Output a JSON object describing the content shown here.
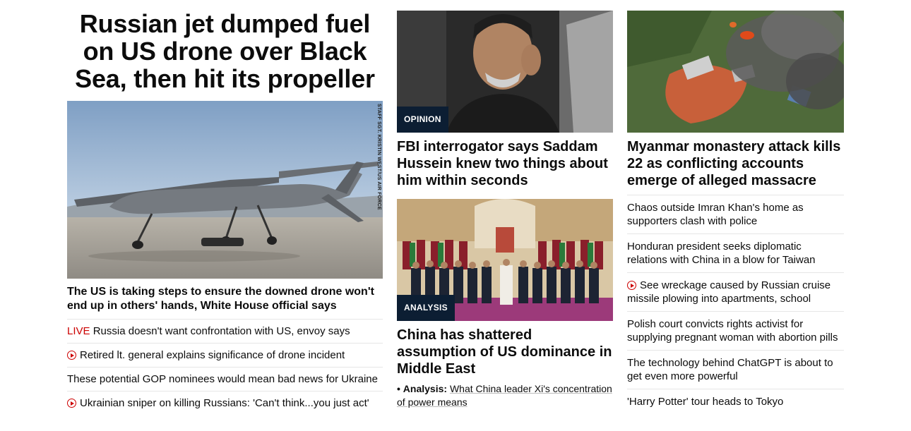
{
  "lead": {
    "title": "Russian jet dumped fuel on US drone over Black Sea, then hit its propeller",
    "image_credit": "STAFF SGT. KRISTIN WEST/US AIR FORCE",
    "subhead": "The US is taking steps to ensure the downed drone won't end up in others' hands, White House official says",
    "items": [
      {
        "prefix": "LIVE",
        "text": "Russia doesn't want confrontation with US, envoy says"
      },
      {
        "icon": "play",
        "text": "Retired lt. general explains significance of drone incident"
      },
      {
        "text": "These potential GOP nominees would mean bad news for Ukraine"
      },
      {
        "icon": "play",
        "text": "Ukrainian sniper on killing Russians: 'Can't think...you just act'"
      }
    ]
  },
  "middle": {
    "story1": {
      "badge": "OPINION",
      "headline": "FBI interrogator says Saddam Hussein knew two things about him within seconds"
    },
    "story2": {
      "badge": "ANALYSIS",
      "headline": "China has shattered assumption of US dominance in Middle East",
      "analysis_bullet": "•",
      "analysis_label": "Analysis:",
      "analysis_link": "What China leader Xi's concentration of power means"
    }
  },
  "right": {
    "headline": "Myanmar monastery attack kills 22 as conflicting accounts emerge of alleged massacre",
    "items": [
      {
        "text": "Chaos outside Imran Khan's home as supporters clash with police"
      },
      {
        "text": "Honduran president seeks diplomatic relations with China in a blow for Taiwan"
      },
      {
        "icon": "play",
        "text": "See wreckage caused by Russian cruise missile plowing into apartments, school"
      },
      {
        "text": "Polish court convicts rights activist for supplying pregnant woman with abortion pills"
      },
      {
        "text": "The technology behind ChatGPT is about to get even more powerful"
      },
      {
        "text": "'Harry Potter' tour heads to Tokyo"
      }
    ]
  },
  "colors": {
    "live": "#cc0000",
    "badge_bg": "#0c1e33",
    "divider": "#e6e6e6"
  }
}
